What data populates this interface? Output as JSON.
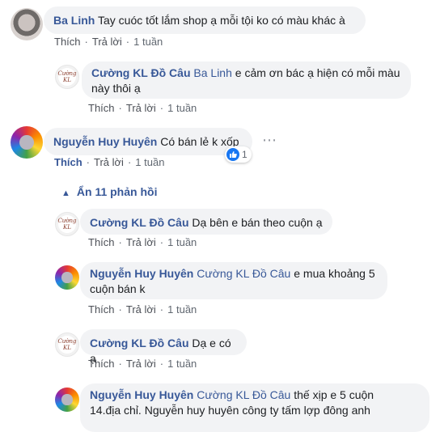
{
  "comments": [
    {
      "author": "Ba Linh",
      "text": "Tay cuóc tốt lắm shop ạ mỗi tội ko có màu khác à",
      "actions": {
        "like": "Thích",
        "reply": "Trả lời",
        "time": "1 tuần"
      }
    },
    {
      "author": "Cường KL Đồ Câu",
      "tag": "Ba Linh",
      "line1": "e cảm ơn bác ạ hiện có mỗi màu",
      "line2": "này thôi ạ",
      "actions": {
        "like": "Thích",
        "reply": "Trả lời",
        "time": "1 tuần"
      }
    },
    {
      "author": "Nguyễn Huy Huyên",
      "text": "Có bán lẻ k xốp",
      "reaction_count": "1",
      "actions": {
        "like": "Thích",
        "reply": "Trả lời",
        "time": "1 tuần"
      },
      "hide_replies": "Ẩn 11 phản hồi"
    },
    {
      "author": "Cường KL Đồ Câu",
      "text": "Dạ bên e bán theo cuộn ạ",
      "actions": {
        "like": "Thích",
        "reply": "Trả lời",
        "time": "1 tuần"
      }
    },
    {
      "author": "Nguyễn Huy Huyên",
      "tag": "Cường KL Đồ Câu",
      "line1": "e mua khoảng 5",
      "line2": "cuộn bán k",
      "actions": {
        "like": "Thích",
        "reply": "Trả lời",
        "time": "1 tuần"
      }
    },
    {
      "author": "Cường KL Đồ Câu",
      "text": "Dạ e có ạ",
      "actions": {
        "like": "Thích",
        "reply": "Trả lời",
        "time": "1 tuần"
      }
    },
    {
      "author": "Nguyễn Huy Huyên",
      "tag": "Cường KL Đồ Câu",
      "line1": "thế xịp e 5 cuộn",
      "line2": "14.địa chỉ. Nguyễn huy huyên công ty tấm lợp đông anh"
    }
  ],
  "shop_avatar_text": "Cường KL",
  "more_icon": "more-horizontal-icon",
  "like_icon": "thumbs-up-icon",
  "colors": {
    "link": "#385898",
    "bubble": "#f2f3f5",
    "meta": "#606770",
    "like_blue": "#1877f2"
  }
}
